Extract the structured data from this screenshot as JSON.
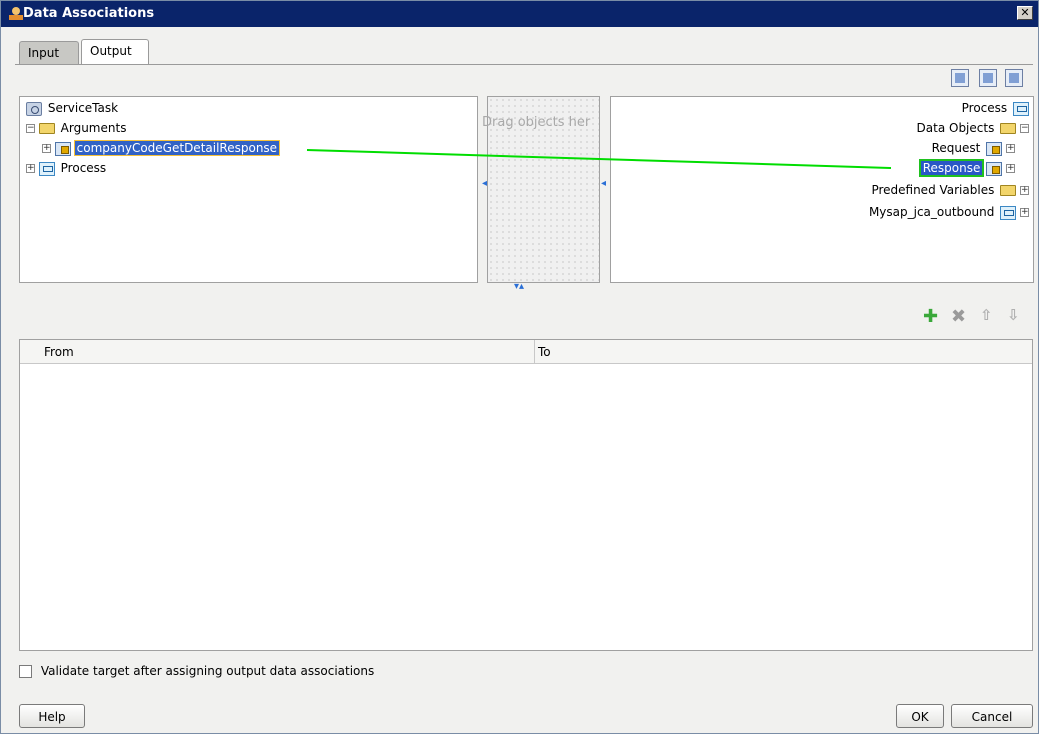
{
  "window": {
    "title": "Data Associations"
  },
  "tabs": [
    {
      "label": "Input",
      "active": false
    },
    {
      "label": "Output",
      "active": true
    }
  ],
  "source_tree": {
    "root": "ServiceTask",
    "items": [
      {
        "label": "Arguments",
        "icon": "folder-icon"
      },
      {
        "label": "companyCodeGetDetailResponse",
        "icon": "variable-icon",
        "selected": true
      },
      {
        "label": "Process",
        "icon": "process-icon"
      }
    ]
  },
  "middle": {
    "drop_hint": "Drag objects her"
  },
  "target_tree": {
    "items": [
      {
        "label": "Process",
        "icon": "process-icon"
      },
      {
        "label": "Data Objects",
        "icon": "folder-icon"
      },
      {
        "label": "Request",
        "icon": "variable-icon"
      },
      {
        "label": "Response",
        "icon": "variable-icon",
        "selected": true
      },
      {
        "label": "Predefined Variables",
        "icon": "folder-icon"
      },
      {
        "label": "Mysap_jca_outbound",
        "icon": "process-icon"
      }
    ]
  },
  "table": {
    "columns": [
      "From",
      "To"
    ]
  },
  "options": {
    "validate_label": "Validate target after assigning output data associations"
  },
  "buttons": {
    "help": "Help",
    "ok": "OK",
    "cancel": "Cancel"
  },
  "colors": {
    "mapping_line": "#00dd00",
    "selection": "#3162c5",
    "titlebar": "#0a246a"
  }
}
